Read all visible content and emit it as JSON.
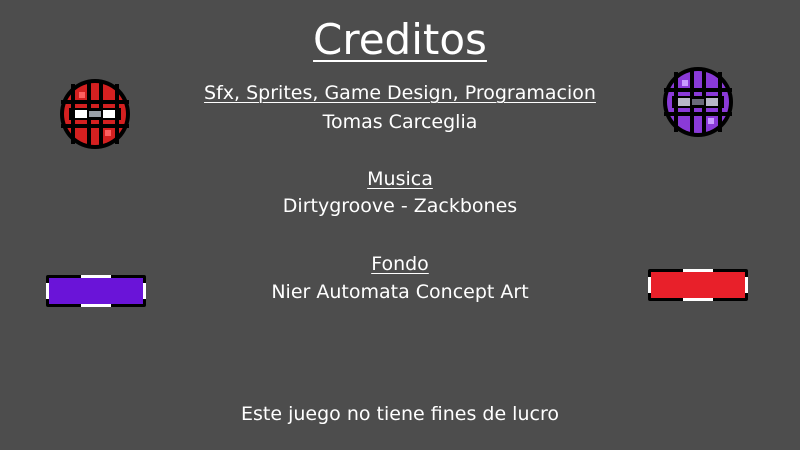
{
  "screen": {
    "title": "Creditos",
    "background_color": "#4d4d4d"
  },
  "sections": [
    {
      "heading": "Sfx, Sprites, Game Design, Programacion",
      "text": "Tomas Carceglia"
    },
    {
      "heading": "Musica",
      "text": "Dirtygroove - Zackbones"
    },
    {
      "heading": "Fondo",
      "text": "Nier Automata Concept Art"
    }
  ],
  "footer": "Este juego no tiene fines de lucro",
  "decorations": {
    "left_ball": {
      "icon": "red-ball-sprite",
      "color": "#d42020"
    },
    "right_ball": {
      "icon": "purple-ball-sprite",
      "color": "#8a3ad8"
    },
    "left_paddle": {
      "icon": "purple-paddle-sprite",
      "color": "#6a14d8"
    },
    "right_paddle": {
      "icon": "red-paddle-sprite",
      "color": "#e8202a"
    }
  }
}
